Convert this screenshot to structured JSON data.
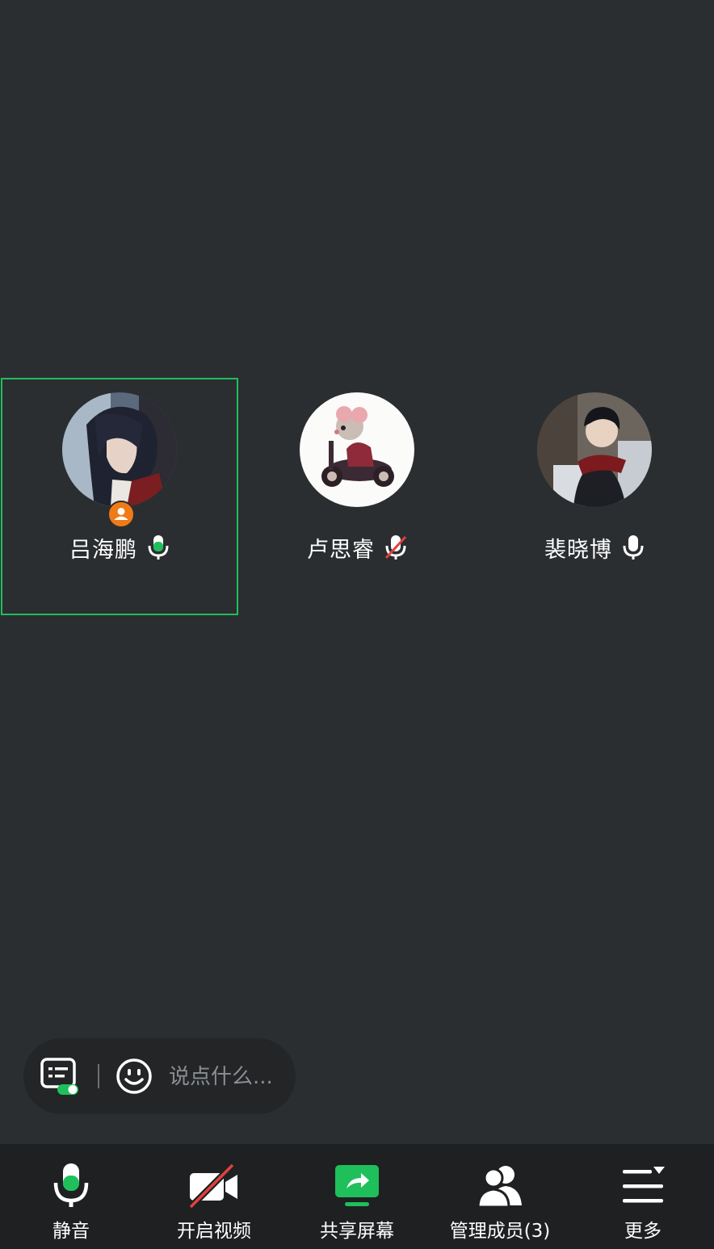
{
  "participants": [
    {
      "name": "吕海鹏",
      "mic": "speaking",
      "is_host": true,
      "active": true
    },
    {
      "name": "卢思睿",
      "mic": "muted",
      "is_host": false,
      "active": false
    },
    {
      "name": "裴晓博",
      "mic": "on",
      "is_host": false,
      "active": false
    }
  ],
  "chat": {
    "placeholder": "说点什么..."
  },
  "toolbar": {
    "mute_label": "静音",
    "video_label": "开启视频",
    "share_label": "共享屏幕",
    "members_label": "管理成员(3)",
    "more_label": "更多"
  },
  "colors": {
    "background": "#2b2e31",
    "accent_green": "#1fbf5c",
    "host_badge": "#f07a16",
    "muted_red": "#e0413c"
  }
}
